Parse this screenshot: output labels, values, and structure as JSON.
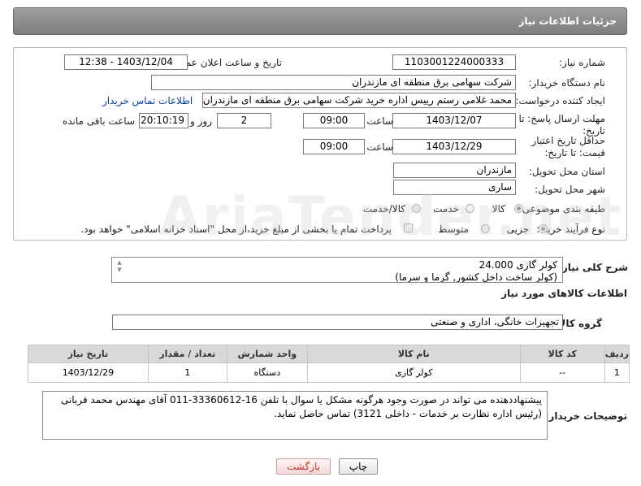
{
  "header": {
    "title": "جزئیات اطلاعات نیاز"
  },
  "form": {
    "need_number_label": "شماره نیاز:",
    "need_number": "1103001224000333",
    "announce_label": "تاریخ و ساعت اعلان عمومی:",
    "announce_value": "1403/12/04 - 12:38",
    "buyer_org_label": "نام دستگاه خریدار:",
    "buyer_org": "شرکت سهامی برق منطقه ای مازندران",
    "creator_label": "ایجاد کننده درخواست:",
    "creator": "محمد غلامی رستم رییس اداره خرید شرکت سهامی برق منطقه ای مازندران",
    "contact_link": "اطلاعات تماس خریدار",
    "deadline_label": "مهلت ارسال پاسخ: تا تاریخ:",
    "deadline_date": "1403/12/07",
    "time_label": "ساعت",
    "deadline_time": "09:00",
    "days_value": "2",
    "days_label": "روز و",
    "remaining_time": "20:10:19",
    "remaining_label": "ساعت باقی مانده",
    "validity_label": "حداقل تاریخ اعتبار قیمت: تا تاریخ:",
    "validity_date": "1403/12/29",
    "validity_time": "09:00",
    "province_label": "استان محل تحویل:",
    "province": "مازندران",
    "city_label": "شهر محل تحویل:",
    "city": "ساری",
    "category_label": "طبقه بندی موضوعی:",
    "category_options": [
      "کالا",
      "خدمت",
      "کالا/خدمت"
    ],
    "process_label": "نوع فرآیند خرید :",
    "process_options": [
      "جزیی",
      "متوسط"
    ],
    "payment_note": "پرداخت تمام یا بخشی از مبلغ خرید،از محل \"اسناد خزانه اسلامی\" خواهد بود."
  },
  "description": {
    "label": "شرح کلی نیاز:",
    "line1": "کولر گازی 24.000",
    "line2": "(کولر ساخت داخل کشور,  گرما و سرما)"
  },
  "goods_info": {
    "title": "اطلاعات کالاهای مورد نیاز",
    "group_label": "گروه کالا:",
    "group_value": "تجهیزات خانگی، اداری و صنعتی",
    "columns": [
      "ردیف",
      "کد کالا",
      "نام کالا",
      "واحد شمارش",
      "تعداد / مقدار",
      "تاریخ نیاز"
    ],
    "rows": [
      [
        "1",
        "--",
        "کولر گازی",
        "دستگاه",
        "1",
        "1403/12/29"
      ]
    ]
  },
  "buyer_notes": {
    "label": "توضیحات خریدار:",
    "text": "پیشنهاددهنده می تواند در صورت وجود هرگونه مشکل یا سوال با تلفن 16-33360612-011 آقای مهندس محمد قربانی (رئیس اداره نظارت بر خدمات - داخلی 3121) تماس حاصل نماید."
  },
  "buttons": {
    "print": "چاپ",
    "back": "بازگشت"
  },
  "watermark": "AriaTender.net"
}
